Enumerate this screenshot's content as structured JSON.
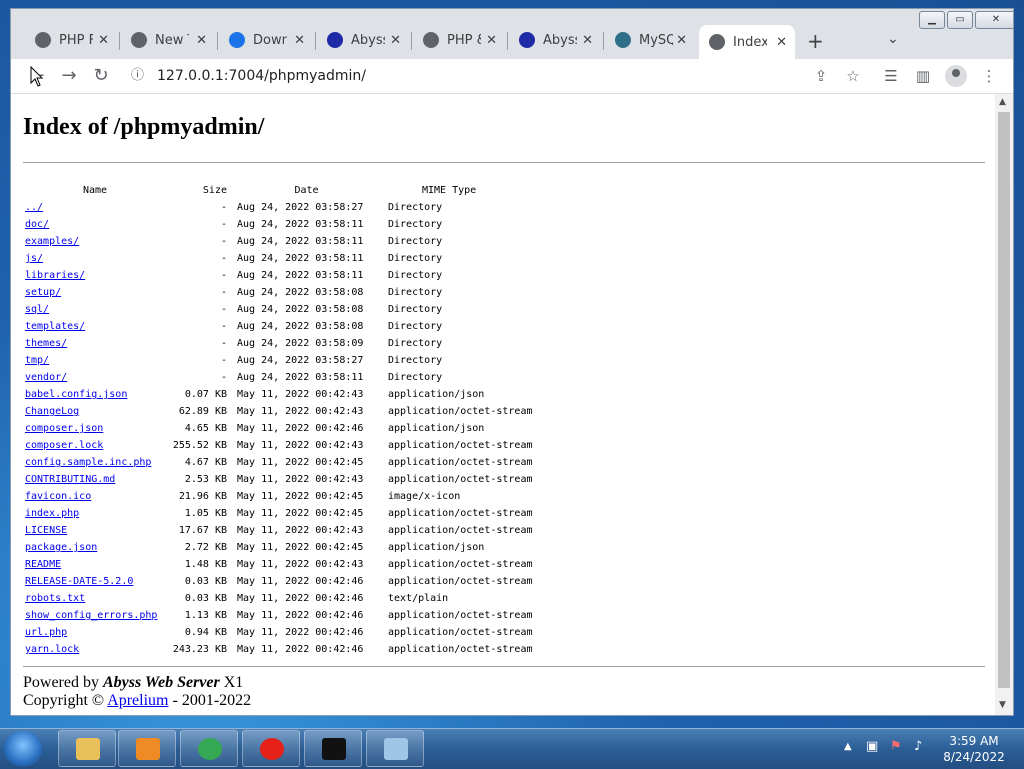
{
  "browser": {
    "tabs": [
      {
        "title": "PHP F",
        "favicon": "globe-icon",
        "color": "#5f6368"
      },
      {
        "title": "New T",
        "favicon": "chrome-icon",
        "color": "#5f6368"
      },
      {
        "title": "Downl",
        "favicon": "download-icon",
        "color": "#1a73e8"
      },
      {
        "title": "Abyss",
        "favicon": "abyss-icon",
        "color": "#1f2aa8"
      },
      {
        "title": "PHP &",
        "favicon": "globe-icon",
        "color": "#5f6368"
      },
      {
        "title": "Abyss",
        "favicon": "abyss-icon",
        "color": "#1f2aa8"
      },
      {
        "title": "MySQ",
        "favicon": "mysql-icon",
        "color": "#2f6f8a"
      },
      {
        "title": "Index",
        "favicon": "globe-icon",
        "color": "#5f6368",
        "active": true
      }
    ],
    "url": "127.0.0.1:7004/phpmyadmin/"
  },
  "page": {
    "title": "Index of /phpmyadmin/",
    "headers": {
      "name": "Name",
      "size": "Size",
      "date": "Date",
      "mime": "MIME Type"
    },
    "rows": [
      {
        "name": "../",
        "size": "-",
        "date": "Aug 24, 2022 03:58:27",
        "mime": "Directory"
      },
      {
        "name": "doc/",
        "size": "-",
        "date": "Aug 24, 2022 03:58:11",
        "mime": "Directory"
      },
      {
        "name": "examples/",
        "size": "-",
        "date": "Aug 24, 2022 03:58:11",
        "mime": "Directory"
      },
      {
        "name": "js/",
        "size": "-",
        "date": "Aug 24, 2022 03:58:11",
        "mime": "Directory"
      },
      {
        "name": "libraries/",
        "size": "-",
        "date": "Aug 24, 2022 03:58:11",
        "mime": "Directory"
      },
      {
        "name": "setup/",
        "size": "-",
        "date": "Aug 24, 2022 03:58:08",
        "mime": "Directory"
      },
      {
        "name": "sql/",
        "size": "-",
        "date": "Aug 24, 2022 03:58:08",
        "mime": "Directory"
      },
      {
        "name": "templates/",
        "size": "-",
        "date": "Aug 24, 2022 03:58:08",
        "mime": "Directory"
      },
      {
        "name": "themes/",
        "size": "-",
        "date": "Aug 24, 2022 03:58:09",
        "mime": "Directory"
      },
      {
        "name": "tmp/",
        "size": "-",
        "date": "Aug 24, 2022 03:58:27",
        "mime": "Directory"
      },
      {
        "name": "vendor/",
        "size": "-",
        "date": "Aug 24, 2022 03:58:11",
        "mime": "Directory"
      },
      {
        "name": "babel.config.json",
        "size": "0.07 KB",
        "date": "May 11, 2022 00:42:43",
        "mime": "application/json"
      },
      {
        "name": "ChangeLog",
        "size": "62.89 KB",
        "date": "May 11, 2022 00:42:43",
        "mime": "application/octet-stream"
      },
      {
        "name": "composer.json",
        "size": "4.65 KB",
        "date": "May 11, 2022 00:42:46",
        "mime": "application/json"
      },
      {
        "name": "composer.lock",
        "size": "255.52 KB",
        "date": "May 11, 2022 00:42:43",
        "mime": "application/octet-stream"
      },
      {
        "name": "config.sample.inc.php",
        "size": "4.67 KB",
        "date": "May 11, 2022 00:42:45",
        "mime": "application/octet-stream"
      },
      {
        "name": "CONTRIBUTING.md",
        "size": "2.53 KB",
        "date": "May 11, 2022 00:42:43",
        "mime": "application/octet-stream"
      },
      {
        "name": "favicon.ico",
        "size": "21.96 KB",
        "date": "May 11, 2022 00:42:45",
        "mime": "image/x-icon"
      },
      {
        "name": "index.php",
        "size": "1.05 KB",
        "date": "May 11, 2022 00:42:45",
        "mime": "application/octet-stream"
      },
      {
        "name": "LICENSE",
        "size": "17.67 KB",
        "date": "May 11, 2022 00:42:43",
        "mime": "application/octet-stream"
      },
      {
        "name": "package.json",
        "size": "2.72 KB",
        "date": "May 11, 2022 00:42:45",
        "mime": "application/json"
      },
      {
        "name": "README",
        "size": "1.48 KB",
        "date": "May 11, 2022 00:42:43",
        "mime": "application/octet-stream"
      },
      {
        "name": "RELEASE-DATE-5.2.0",
        "size": "0.03 KB",
        "date": "May 11, 2022 00:42:46",
        "mime": "application/octet-stream"
      },
      {
        "name": "robots.txt",
        "size": "0.03 KB",
        "date": "May 11, 2022 00:42:46",
        "mime": "text/plain"
      },
      {
        "name": "show_config_errors.php",
        "size": "1.13 KB",
        "date": "May 11, 2022 00:42:46",
        "mime": "application/octet-stream"
      },
      {
        "name": "url.php",
        "size": "0.94 KB",
        "date": "May 11, 2022 00:42:46",
        "mime": "application/octet-stream"
      },
      {
        "name": "yarn.lock",
        "size": "243.23 KB",
        "date": "May 11, 2022 00:42:46",
        "mime": "application/octet-stream"
      }
    ],
    "footer": {
      "powered_prefix": "Powered by",
      "server_name": "Abyss Web Server",
      "server_version": "X1",
      "copyright_prefix": "Copyright ©",
      "company": "Aprelium",
      "years": "- 2001-2022"
    }
  },
  "taskbar": {
    "apps": [
      {
        "name": "explorer-icon",
        "color": "#e8c15a"
      },
      {
        "name": "media-player-icon",
        "color": "#f08a24"
      },
      {
        "name": "chrome-icon",
        "color": "#34a853"
      },
      {
        "name": "youtube-music-icon",
        "color": "#e62117"
      },
      {
        "name": "cmd-icon",
        "color": "#111111"
      },
      {
        "name": "notepad-icon",
        "color": "#9ec7e6"
      }
    ],
    "time": "3:59 AM",
    "date": "8/24/2022"
  }
}
